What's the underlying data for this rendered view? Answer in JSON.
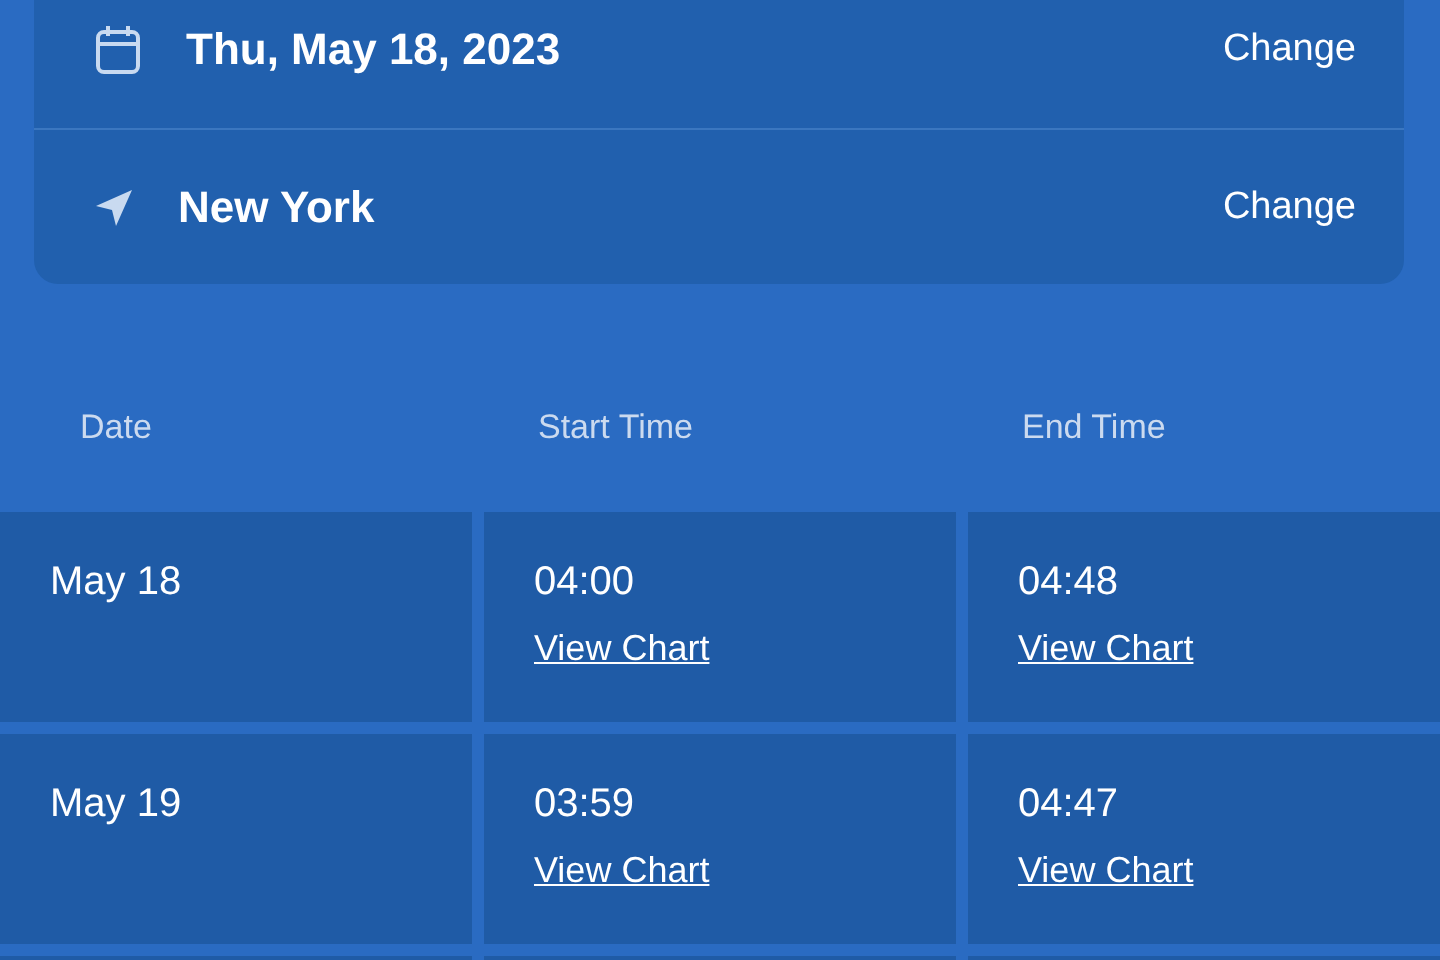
{
  "settings": [
    {
      "kind": "date",
      "value": "Thu, May 18, 2023",
      "action": "Change"
    },
    {
      "kind": "location",
      "value": "New York",
      "action": "Change"
    }
  ],
  "table": {
    "columns": [
      "Date",
      "Start Time",
      "End Time"
    ],
    "rows": [
      {
        "date": "May 18",
        "start": "04:00",
        "start_link": "View Chart",
        "end": "04:48",
        "end_link": "View Chart"
      },
      {
        "date": "May 19",
        "start": "03:59",
        "start_link": "View Chart",
        "end": "04:47",
        "end_link": "View Chart"
      }
    ]
  }
}
